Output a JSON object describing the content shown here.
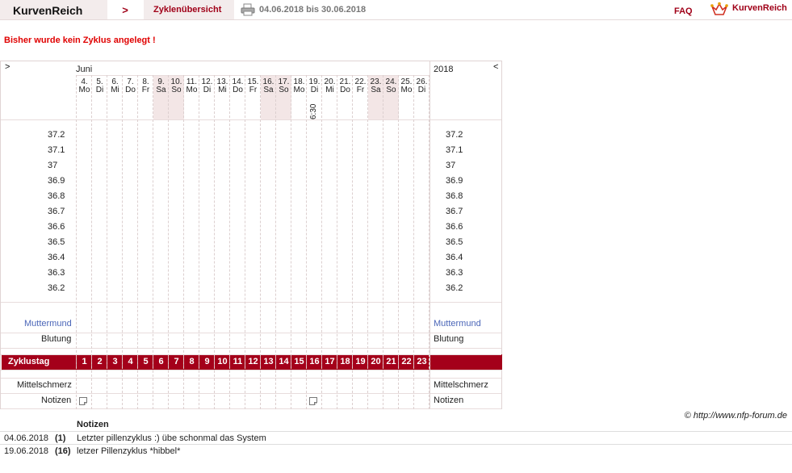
{
  "header": {
    "brand": "KurvenReich",
    "nav_arrow": ">",
    "breadcrumb": "Zyklenübersicht",
    "date_range": "04.06.2018 bis 30.06.2018",
    "faq": "FAQ",
    "logo_text": "KurvenReich",
    "print_icon": "printer-icon"
  },
  "warning": "Bisher wurde kein Zyklus angelegt !",
  "chart": {
    "nav_prev": ">",
    "nav_next": "<",
    "month": "Juni",
    "year": "2018",
    "days": [
      {
        "num": "4.",
        "wd": "Mo",
        "we": false
      },
      {
        "num": "5.",
        "wd": "Di",
        "we": false
      },
      {
        "num": "6.",
        "wd": "Mi",
        "we": false
      },
      {
        "num": "7.",
        "wd": "Do",
        "we": false
      },
      {
        "num": "8.",
        "wd": "Fr",
        "we": false
      },
      {
        "num": "9.",
        "wd": "Sa",
        "we": true
      },
      {
        "num": "10.",
        "wd": "So",
        "we": true
      },
      {
        "num": "11.",
        "wd": "Mo",
        "we": false
      },
      {
        "num": "12.",
        "wd": "Di",
        "we": false
      },
      {
        "num": "13.",
        "wd": "Mi",
        "we": false
      },
      {
        "num": "14.",
        "wd": "Do",
        "we": false
      },
      {
        "num": "15.",
        "wd": "Fr",
        "we": false
      },
      {
        "num": "16.",
        "wd": "Sa",
        "we": true
      },
      {
        "num": "17.",
        "wd": "So",
        "we": true
      },
      {
        "num": "18.",
        "wd": "Mo",
        "we": false
      },
      {
        "num": "19.",
        "wd": "Di",
        "we": false
      },
      {
        "num": "20.",
        "wd": "Mi",
        "we": false
      },
      {
        "num": "21.",
        "wd": "Do",
        "we": false
      },
      {
        "num": "22.",
        "wd": "Fr",
        "we": false
      },
      {
        "num": "23.",
        "wd": "Sa",
        "we": true
      },
      {
        "num": "24.",
        "wd": "So",
        "we": true
      },
      {
        "num": "25.",
        "wd": "Mo",
        "we": false
      },
      {
        "num": "26.",
        "wd": "Di",
        "we": false
      }
    ],
    "time_note": {
      "day_index": 15,
      "text": "6:30"
    },
    "temperatures": [
      "37.2",
      "37.1",
      "37",
      "36.9",
      "36.8",
      "36.7",
      "36.6",
      "36.5",
      "36.4",
      "36.3",
      "36.2"
    ],
    "row_labels": {
      "muttermund": "Muttermund",
      "blutung": "Blutung",
      "zyklustag": "Zyklustag",
      "mittelschmerz": "Mittelschmerz",
      "notizen": "Notizen"
    },
    "cycle_days": [
      "1",
      "2",
      "3",
      "4",
      "5",
      "6",
      "7",
      "8",
      "9",
      "10",
      "11",
      "12",
      "13",
      "14",
      "15",
      "16",
      "17",
      "18",
      "19",
      "20",
      "21",
      "22",
      "23"
    ],
    "note_icon_days": [
      0,
      15
    ]
  },
  "copyright": "© http://www.nfp-forum.de",
  "notes": {
    "header": "Notizen",
    "rows": [
      {
        "date": "04.06.2018",
        "day": "(1)",
        "text": "Letzter pillenzyklus :) übe schonmal das System"
      },
      {
        "date": "19.06.2018",
        "day": "(16)",
        "text": "letzer Pillenzyklus *hibbel*"
      }
    ]
  }
}
